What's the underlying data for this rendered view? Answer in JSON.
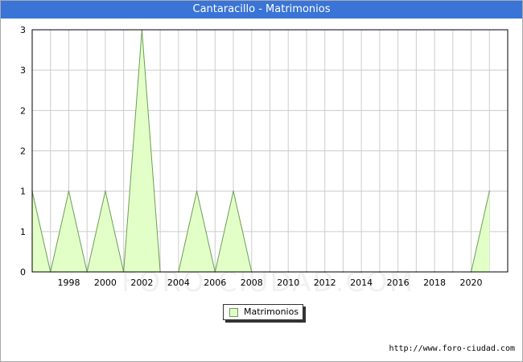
{
  "title": "Cantaracillo - Matrimonios",
  "source": "http://www.foro-ciudad.com",
  "watermark": "FORO-CIUDAD.COM",
  "colors": {
    "title_bg": "#3a74d6",
    "area_fill": "#e3ffc8",
    "line": "#6a9e52",
    "grid": "#cccccc"
  },
  "chart_data": {
    "type": "area",
    "series": [
      {
        "name": "Matrimonios",
        "x": [
          1996,
          1997,
          1998,
          1999,
          2000,
          2001,
          2002,
          2003,
          2004,
          2005,
          2006,
          2007,
          2008,
          2009,
          2010,
          2011,
          2012,
          2013,
          2014,
          2015,
          2016,
          2017,
          2018,
          2019,
          2020,
          2021
        ],
        "values": [
          1,
          0,
          1,
          0,
          1,
          0,
          3,
          0,
          0,
          1,
          0,
          1,
          0,
          0,
          0,
          0,
          0,
          0,
          0,
          0,
          0,
          0,
          0,
          0,
          0,
          1
        ]
      }
    ],
    "xlim": [
      1996,
      2022
    ],
    "ylim": [
      0,
      3
    ],
    "x_ticks": [
      1998,
      2000,
      2002,
      2004,
      2006,
      2008,
      2010,
      2012,
      2014,
      2016,
      2018,
      2020
    ],
    "y_ticks": [
      0,
      0.5,
      1,
      1.5,
      2,
      2.5,
      3
    ],
    "y_tick_labels": [
      "0",
      "1",
      "1",
      "2",
      "2",
      "3",
      "3"
    ],
    "grid": true,
    "legend": "bottom-center",
    "xlabel": "",
    "ylabel": ""
  }
}
